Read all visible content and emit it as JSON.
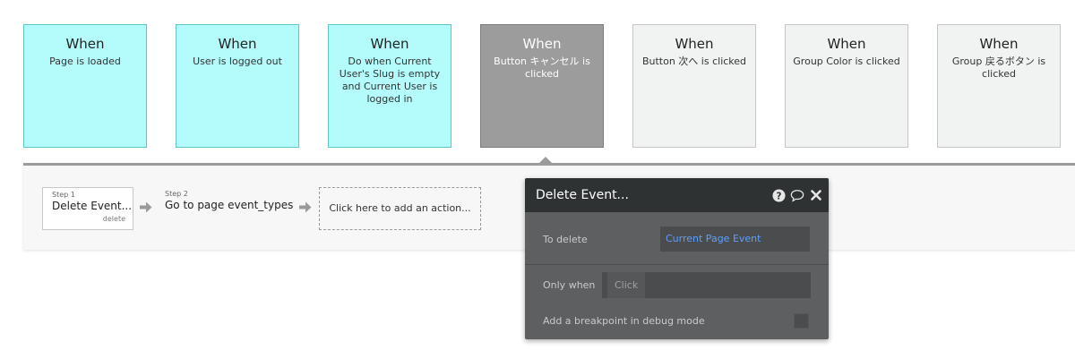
{
  "events": [
    {
      "when": "When",
      "desc": "Page is loaded",
      "style": "cyan"
    },
    {
      "when": "When",
      "desc": "User is logged out",
      "style": "cyan"
    },
    {
      "when": "When",
      "desc": "Do when Current User's Slug is empty and Current User is logged in",
      "style": "cyan"
    },
    {
      "when": "When",
      "desc": "Button キャンセル is clicked",
      "style": "dark"
    },
    {
      "when": "When",
      "desc": "Button 次へ is clicked",
      "style": "gray"
    },
    {
      "when": "When",
      "desc": "Group Color is clicked",
      "style": "gray"
    },
    {
      "when": "When",
      "desc": "Group 戻るボタン is clicked",
      "style": "gray"
    }
  ],
  "workflow": {
    "step1": {
      "num": "Step 1",
      "name": "Delete Event...",
      "sub": "delete"
    },
    "step2": {
      "num": "Step 2",
      "name": "Go to page event_types"
    },
    "add_action": "Click here to add an action..."
  },
  "panel": {
    "title": "Delete Event...",
    "to_delete_label": "To delete",
    "to_delete_value": "Current Page Event",
    "only_when_label": "Only when",
    "only_when_placeholder": "Click",
    "breakpoint_label": "Add a breakpoint in debug mode"
  },
  "icons": {
    "help": "help-circle-icon",
    "comment": "comment-bubble-icon",
    "close": "close-icon",
    "arrow": "arrow-right-icon"
  }
}
